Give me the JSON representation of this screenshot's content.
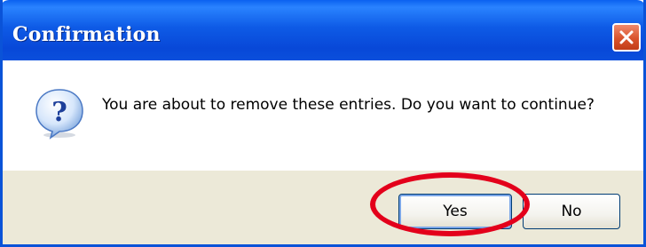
{
  "window": {
    "title": "Confirmation",
    "close_icon": "close-icon",
    "close_color": "#d9532c",
    "titlebar_color": "#0a53d8"
  },
  "content": {
    "icon": "question-icon",
    "message": "You are about to remove these entries. Do you want to continue?"
  },
  "buttons": {
    "yes_label": "Yes",
    "no_label": "No"
  },
  "annotation": {
    "type": "ellipse-highlight",
    "target": "yes-button",
    "color": "#e3001b"
  }
}
